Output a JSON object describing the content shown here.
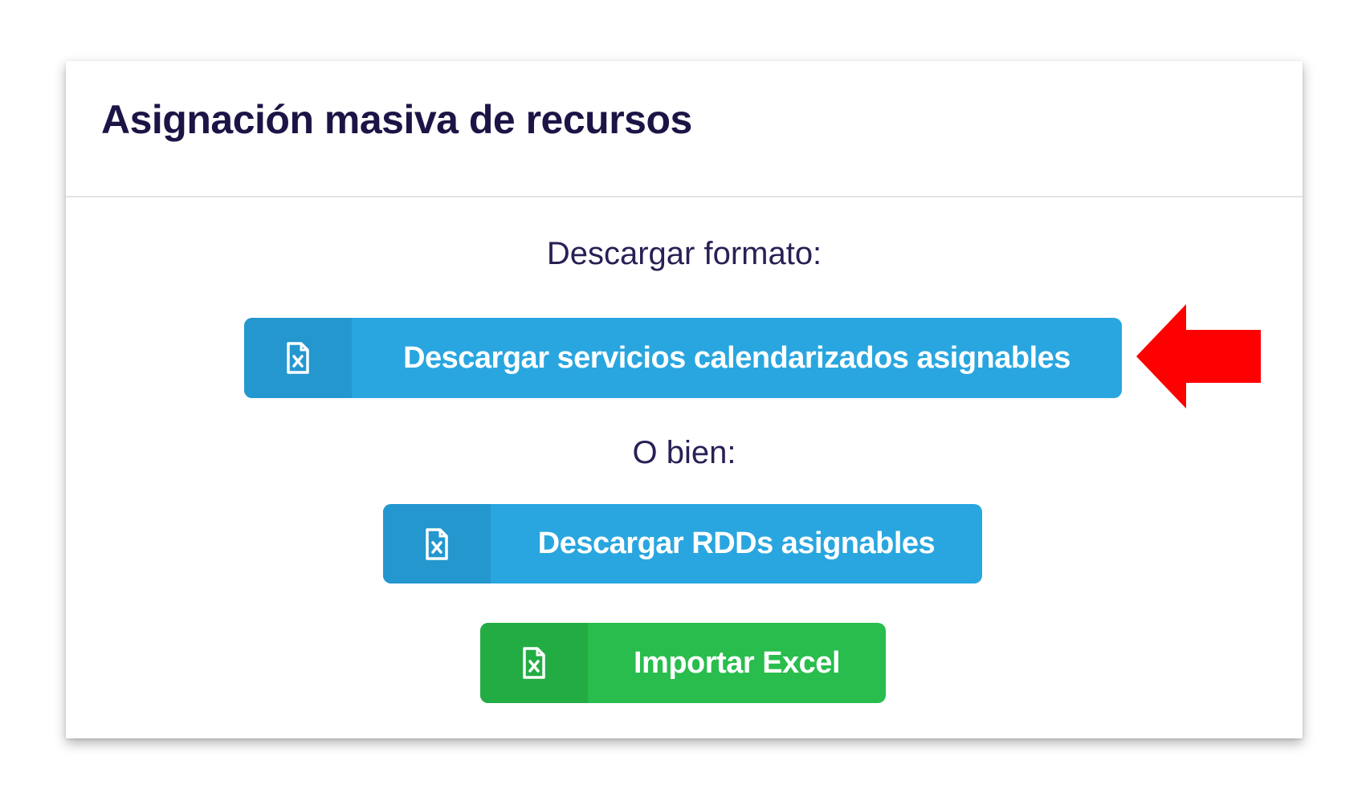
{
  "panel": {
    "title": "Asignación masiva de recursos",
    "download_format_label": "Descargar formato:",
    "or_label": "O bien:"
  },
  "buttons": {
    "download_scheduled_services": {
      "label": "Descargar servicios calendarizados asignables",
      "icon": "excel-file-icon",
      "color": "#29a6df"
    },
    "download_rdds": {
      "label": "Descargar RDDs asignables",
      "icon": "excel-file-icon",
      "color": "#29a6df"
    },
    "import_excel": {
      "label": "Importar Excel",
      "icon": "excel-file-icon",
      "color": "#28bd4c"
    }
  },
  "annotation": {
    "icon": "red-arrow-left-icon",
    "color": "#ff0000"
  }
}
